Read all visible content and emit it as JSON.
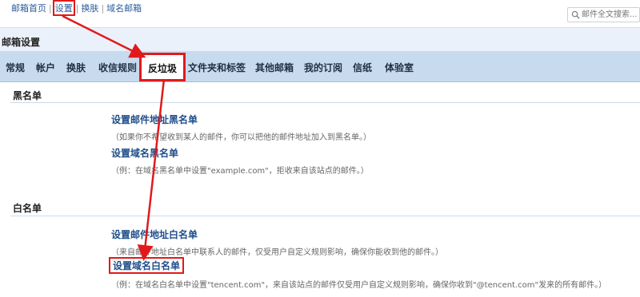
{
  "topbar": {
    "links": [
      "邮箱首页",
      "设置",
      "换肤",
      "域名邮箱"
    ],
    "separator": "|",
    "search_placeholder": "邮件全文搜索..."
  },
  "page": {
    "title": "邮箱设置"
  },
  "tabs": [
    {
      "label": "常规"
    },
    {
      "label": "帐户"
    },
    {
      "label": "换肤"
    },
    {
      "label": "收信规则"
    },
    {
      "label": "反垃圾",
      "active": true
    },
    {
      "label": "文件夹和标签"
    },
    {
      "label": "其他邮箱"
    },
    {
      "label": "我的订阅"
    },
    {
      "label": "信纸"
    },
    {
      "label": "体验室"
    }
  ],
  "blacklist": {
    "title": "黑名单",
    "items": [
      {
        "link": "设置邮件地址黑名单",
        "desc": "（如果你不希望收到某人的邮件，你可以把他的邮件地址加入到黑名单。）"
      },
      {
        "link": "设置域名黑名单",
        "desc": "（例：在域名黑名单中设置\"example.com\"，拒收来自该站点的邮件。）"
      }
    ]
  },
  "whitelist": {
    "title": "白名单",
    "items": [
      {
        "link": "设置邮件地址白名单",
        "desc": "（来自邮件地址白名单中联系人的邮件，仅受用户自定义规则影响，确保你能收到他的邮件。）"
      },
      {
        "link": "设置域名白名单",
        "desc": "（例：在域名白名单中设置\"tencent.com\"，来自该站点的邮件仅受用户自定义规则影响，确保你收到\"@tencent.com\"发来的所有邮件。）"
      }
    ]
  },
  "colors": {
    "accent": "#e2191b",
    "tab_bar": "#c7daee",
    "link": "#1f4e8a"
  }
}
